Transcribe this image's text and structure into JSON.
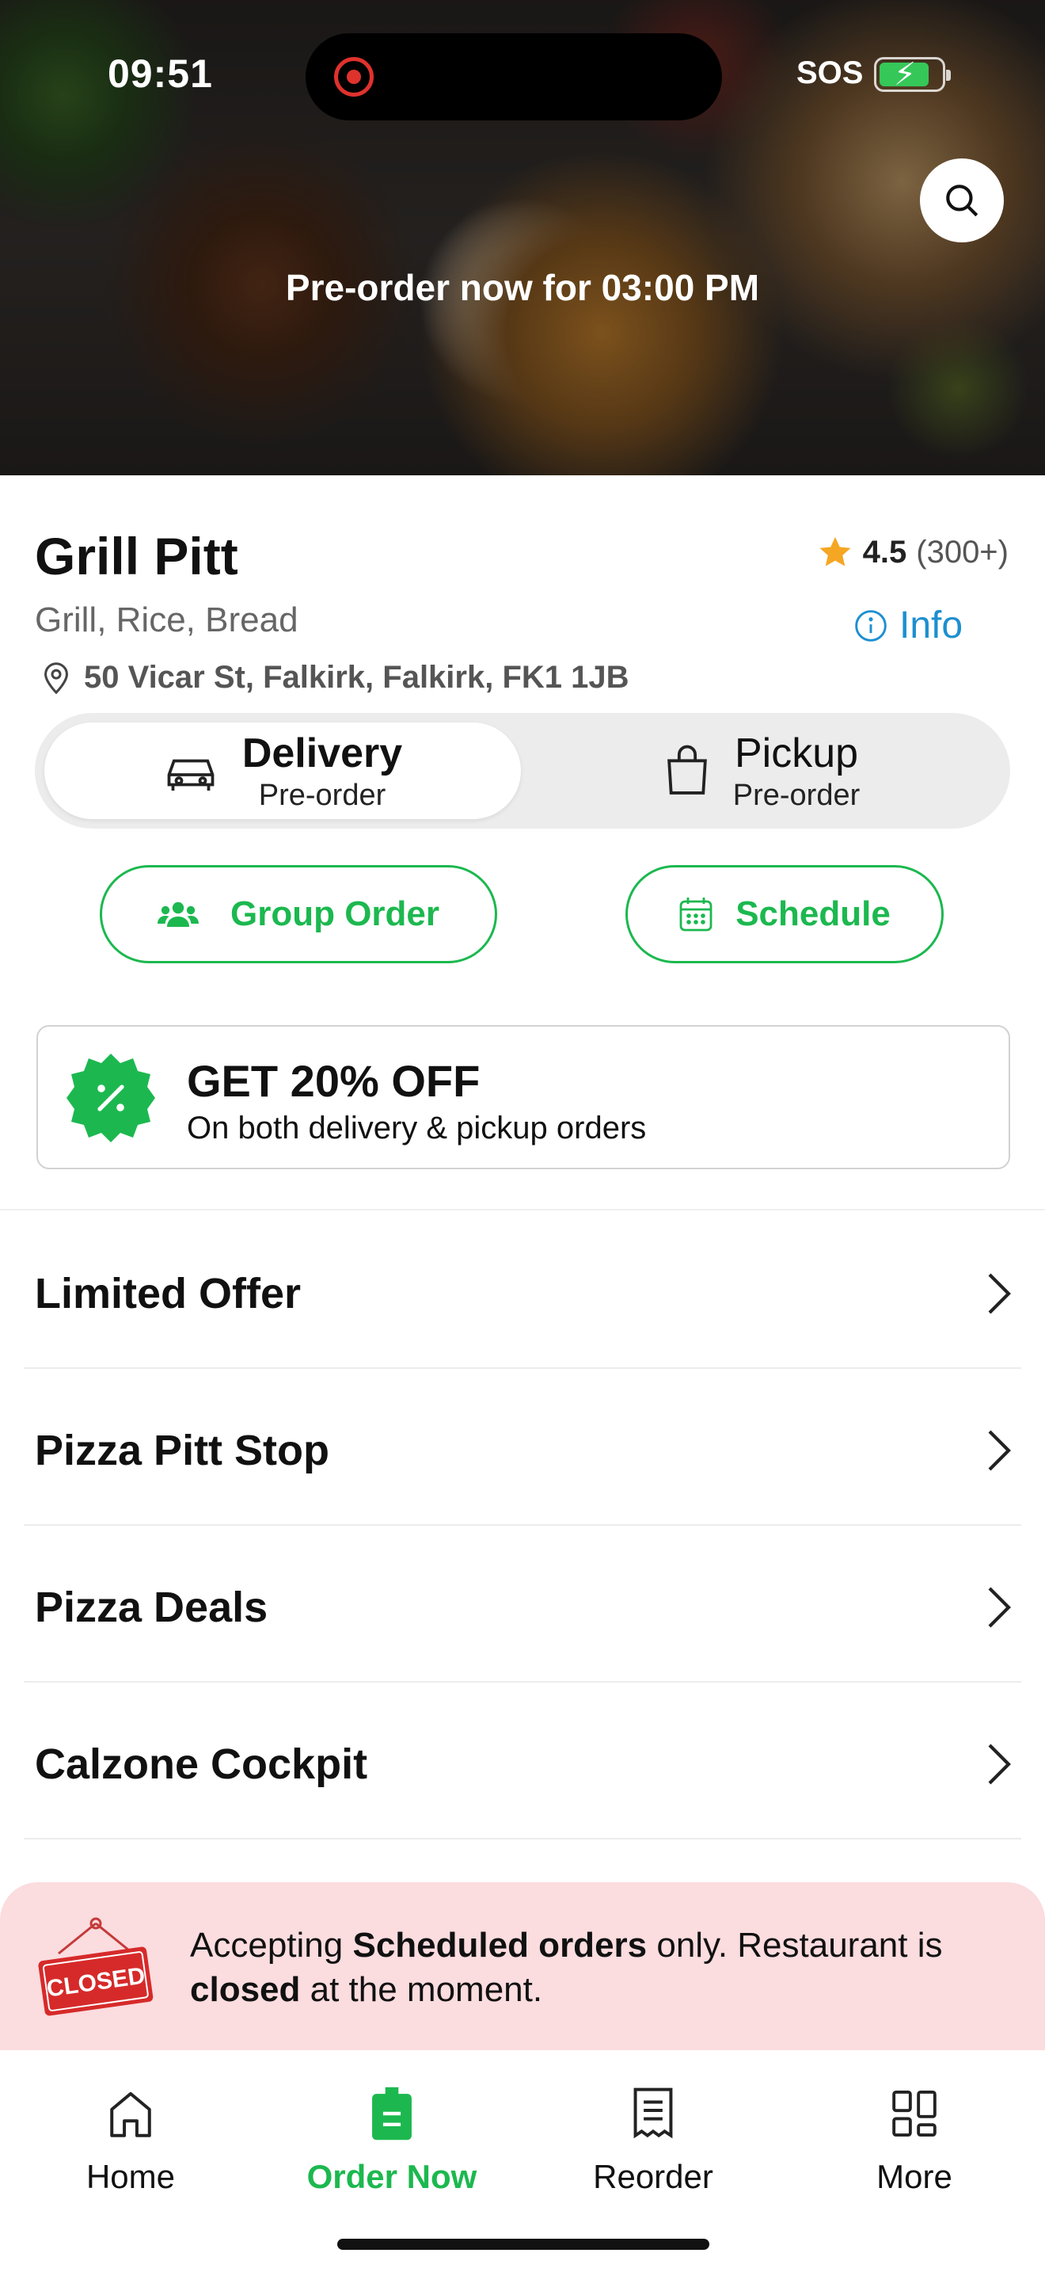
{
  "status_bar": {
    "time": "09:51",
    "carrier": "SOS"
  },
  "hero": {
    "banner_text": "Pre-order now for 03:00 PM",
    "search_icon": "search-icon"
  },
  "restaurant": {
    "name": "Grill Pitt",
    "rating": "4.5",
    "rating_count": "(300+)",
    "cuisines": "Grill, Rice, Bread",
    "info_label": "Info",
    "address": "50 Vicar St, Falkirk, Falkirk, FK1 1JB"
  },
  "order_mode": {
    "selected": "Delivery",
    "options": [
      {
        "label": "Delivery",
        "sub": "Pre-order",
        "icon": "car-icon"
      },
      {
        "label": "Pickup",
        "sub": "Pre-order",
        "icon": "shopping-bag-icon"
      }
    ]
  },
  "actions": {
    "group_order_label": "Group Order",
    "schedule_label": "Schedule"
  },
  "promo": {
    "title": "GET 20% OFF",
    "subtitle": "On both delivery & pickup orders"
  },
  "categories": [
    {
      "label": "Limited Offer"
    },
    {
      "label": "Pizza Pitt Stop"
    },
    {
      "label": "Pizza Deals"
    },
    {
      "label": "Calzone Cockpit"
    }
  ],
  "closed_notice": {
    "sign_text": "CLOSED",
    "part1": "Accepting ",
    "bold1": "Scheduled orders",
    "part2": " only. Restaurant is ",
    "bold2": "closed",
    "part3": " at the moment."
  },
  "tab_bar": {
    "active": "Order Now",
    "items": [
      {
        "label": "Home",
        "icon": "home-icon"
      },
      {
        "label": "Order Now",
        "icon": "order-bag-icon"
      },
      {
        "label": "Reorder",
        "icon": "receipt-icon"
      },
      {
        "label": "More",
        "icon": "grid-icon"
      }
    ]
  },
  "colors": {
    "accent": "#1cb84f",
    "info": "#1d8fd0",
    "star": "#f5a623",
    "closed_bg": "#fbdcdf",
    "closed_sign": "#d62a2a"
  }
}
